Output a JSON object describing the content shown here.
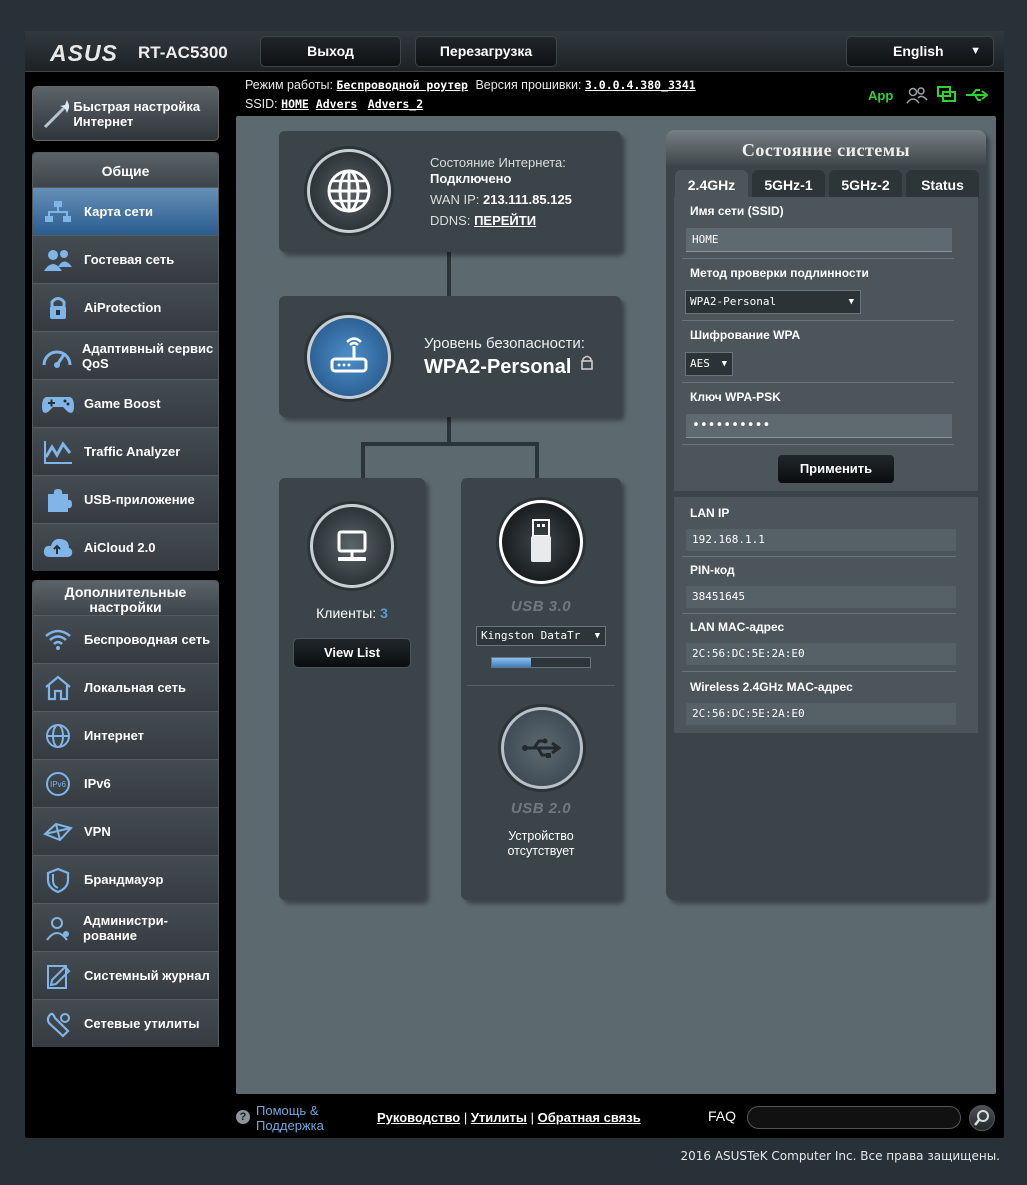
{
  "header": {
    "brand": "ASUS",
    "model": "RT-AC5300",
    "logout_label": "Выход",
    "reboot_label": "Перезагрузка",
    "language": "English"
  },
  "info": {
    "mode_label": "Режим работы:",
    "mode_value": "Беспроводной роутер",
    "fw_label": "Версия прошивки:",
    "fw_value": "3.0.0.4.380_3341",
    "ssid_label": "SSID:",
    "ssids": [
      "HOME",
      "Advers",
      "Advers_2"
    ],
    "app_label": "App"
  },
  "sidebar": {
    "quick_setup": "Быстрая настройка Интернет",
    "general_title": "Общие",
    "general_items": [
      {
        "label": "Карта сети",
        "icon": "network-map-icon"
      },
      {
        "label": "Гостевая сеть",
        "icon": "guest-network-icon"
      },
      {
        "label": "AiProtection",
        "icon": "lock-icon"
      },
      {
        "label": "Адаптивный сервис QoS",
        "icon": "gauge-icon"
      },
      {
        "label": "Game Boost",
        "icon": "gamepad-icon"
      },
      {
        "label": "Traffic Analyzer",
        "icon": "traffic-icon"
      },
      {
        "label": "USB-приложение",
        "icon": "puzzle-icon"
      },
      {
        "label": "AiCloud 2.0",
        "icon": "cloud-icon"
      }
    ],
    "advanced_title": "Дополнительные настройки",
    "advanced_items": [
      {
        "label": "Беспроводная сеть",
        "icon": "wifi-icon"
      },
      {
        "label": "Локальная сеть",
        "icon": "home-icon"
      },
      {
        "label": "Интернет",
        "icon": "globe-icon"
      },
      {
        "label": "IPv6",
        "icon": "ipv6-icon"
      },
      {
        "label": "VPN",
        "icon": "vpn-icon"
      },
      {
        "label": "Брандмауэр",
        "icon": "shield-icon"
      },
      {
        "label": "Администри-рование",
        "icon": "admin-icon"
      },
      {
        "label": "Системный журнал",
        "icon": "log-icon"
      },
      {
        "label": "Сетевые утилиты",
        "icon": "tools-icon"
      }
    ]
  },
  "map": {
    "internet_status_label": "Состояние Интернета:",
    "internet_status_value": "Подключено",
    "wan_ip_label": "WAN IP:",
    "wan_ip_value": "213.111.85.125",
    "ddns_label": "DDNS:",
    "ddns_link": "ПЕРЕЙТИ",
    "security_label": "Уровень безопасности:",
    "security_value": "WPA2-Personal",
    "clients_label": "Клиенты:",
    "clients_count": "3",
    "view_list": "View List",
    "usb3_label": "USB 3.0",
    "usb3_device": "Kingston DataTr",
    "usb3_progress": 0.4,
    "usb2_label": "USB 2.0",
    "usb2_status": "Устройство отсутствует"
  },
  "system": {
    "title": "Состояние системы",
    "tabs": [
      "2.4GHz",
      "5GHz-1",
      "5GHz-2",
      "Status"
    ],
    "ssid_label": "Имя сети (SSID)",
    "ssid_value": "HOME",
    "auth_label": "Метод проверки подлинности",
    "auth_value": "WPA2-Personal",
    "enc_label": "Шифрование WPA",
    "enc_value": "AES",
    "psk_label": "Ключ WPA-PSK",
    "psk_value": "••••••••••",
    "apply": "Применить",
    "lan_ip_label": "LAN IP",
    "lan_ip_value": "192.168.1.1",
    "pin_label": "PIN-код",
    "pin_value": "38451645",
    "lan_mac_label": "LAN MAC-адрес",
    "lan_mac_value": "2C:56:DC:5E:2A:E0",
    "wl_mac_label": "Wireless 2.4GHz MAC-адрес",
    "wl_mac_value": "2C:56:DC:5E:2A:E0"
  },
  "footer": {
    "help": "Помощь & Поддержка",
    "manual": "Руководство",
    "utilities": "Утилиты",
    "feedback": "Обратная связь",
    "faq": "FAQ",
    "copyright": "2016 ASUSTeK Computer Inc. Все права защищены."
  },
  "colors": {
    "accent": "#5b9bd5",
    "status_green": "#2fd12f",
    "active_nav": "#2a5c8f"
  }
}
